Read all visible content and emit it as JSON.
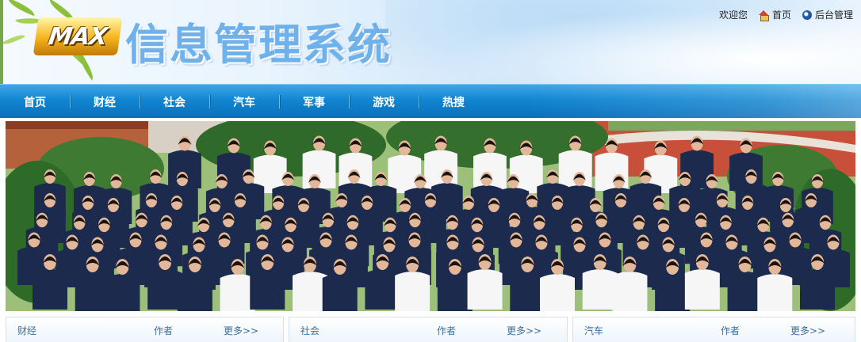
{
  "header": {
    "logo_badge": "MAX",
    "title": "信息管理系统",
    "welcome": "欢迎您",
    "home_link": "首页",
    "admin_link": "后台管理"
  },
  "nav": {
    "items": [
      {
        "label": "首页"
      },
      {
        "label": "财经"
      },
      {
        "label": "社会"
      },
      {
        "label": "汽车"
      },
      {
        "label": "军事"
      },
      {
        "label": "游戏"
      },
      {
        "label": "热搜"
      }
    ]
  },
  "banner": {
    "subject": "group-photo",
    "colors": {
      "shirt_dark": "#1c2a4e",
      "shirt_white": "#f6f6f6",
      "foliage": "#3f7a32",
      "track": "#c8503a"
    }
  },
  "sections": [
    {
      "title": "财经",
      "author_label": "作者",
      "more": "更多>>"
    },
    {
      "title": "社会",
      "author_label": "作者",
      "more": "更多>>"
    },
    {
      "title": "汽车",
      "author_label": "作者",
      "more": "更多>>"
    }
  ],
  "colors": {
    "nav_blue": "#1186d2",
    "header_bg": "#eaf4fd",
    "title_blue": "#6fb1ea",
    "section_text": "#3a6fa0"
  }
}
